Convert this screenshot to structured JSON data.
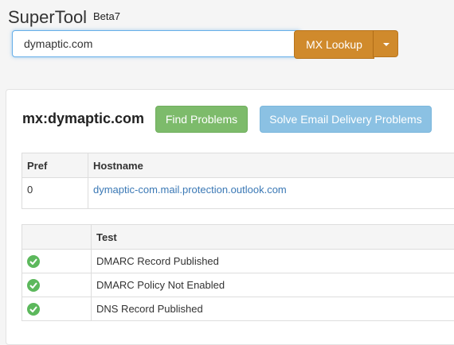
{
  "header": {
    "brand": "SuperTool",
    "badge": "Beta7",
    "search_value": "dymaptic.com",
    "lookup_label": "MX Lookup"
  },
  "result": {
    "title": "mx:dymaptic.com",
    "find_label": "Find Problems",
    "solve_label": "Solve Email Delivery Problems"
  },
  "mx_table": {
    "headers": [
      "Pref",
      "Hostname"
    ],
    "rows": [
      {
        "pref": "0",
        "hostname": "dymaptic-com.mail.protection.outlook.com"
      }
    ]
  },
  "test_table": {
    "headers": [
      "",
      "Test"
    ],
    "rows": [
      {
        "status_icon": "check-circle-icon",
        "test": "DMARC Record Published"
      },
      {
        "status_icon": "check-circle-icon",
        "test": "DMARC Policy Not Enabled"
      },
      {
        "status_icon": "check-circle-icon",
        "test": "DNS Record Published"
      }
    ]
  },
  "colors": {
    "lookup_button": "#d08a2c",
    "find_button": "#7dbb6b",
    "solve_button": "#8bc1e3",
    "success": "#5cb85c",
    "link": "#3a78b5"
  }
}
